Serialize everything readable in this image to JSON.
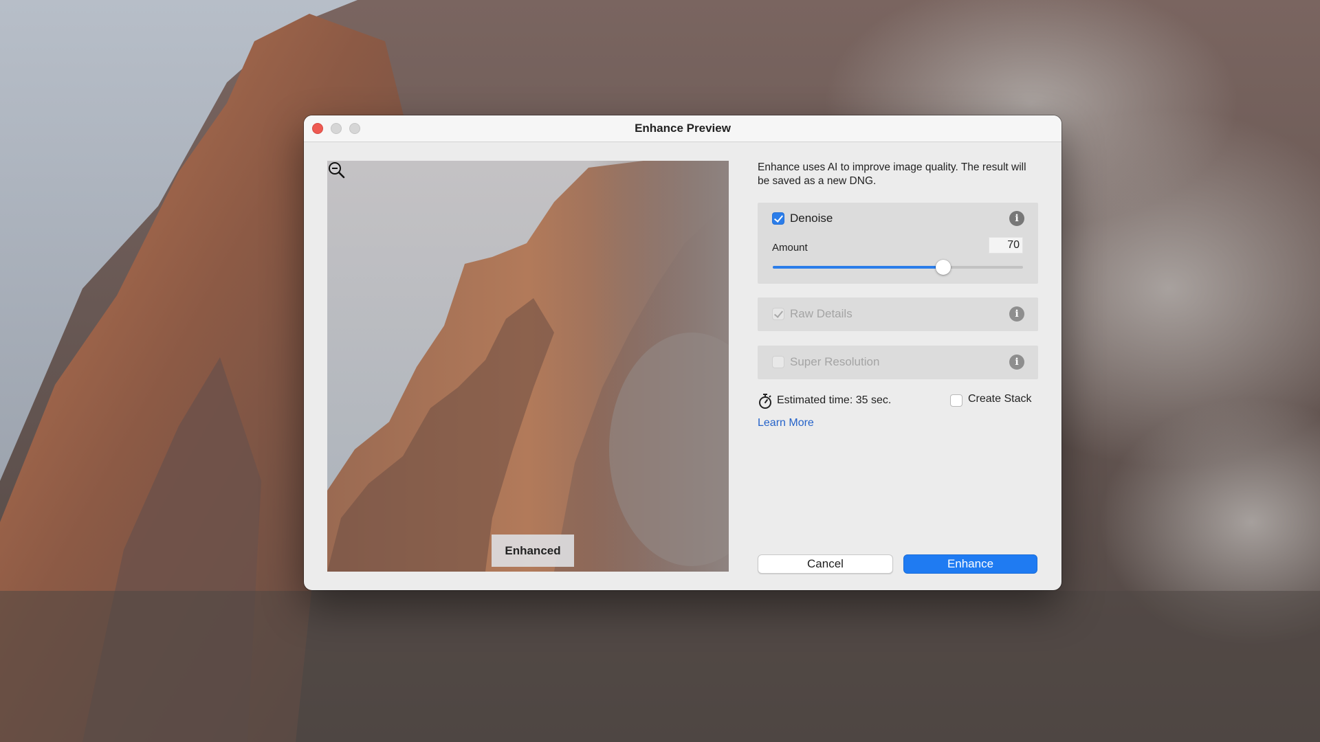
{
  "dialog": {
    "title": "Enhance Preview",
    "description": "Enhance uses AI to improve image quality. The result will be saved as a new DNG.",
    "preview": {
      "badge_label": "Enhanced",
      "zoom_icon": "zoom-out-icon"
    },
    "denoise": {
      "label": "Denoise",
      "checked": true,
      "amount_label": "Amount",
      "amount_value": "70",
      "slider_fraction": 0.68,
      "info_icon": "info-icon"
    },
    "raw_details": {
      "label": "Raw Details",
      "checked": true,
      "enabled": false,
      "info_icon": "info-icon"
    },
    "super_resolution": {
      "label": "Super Resolution",
      "checked": false,
      "enabled": false,
      "info_icon": "info-icon"
    },
    "estimated_time": "Estimated time: 35 sec.",
    "timer_icon": "stopwatch-icon",
    "create_stack": {
      "label": "Create Stack",
      "checked": false
    },
    "learn_more": "Learn More",
    "buttons": {
      "cancel": "Cancel",
      "enhance": "Enhance"
    }
  },
  "colors": {
    "accent": "#1f7bf2",
    "checkbox_checked": "#2b7de9",
    "link": "#2563c9",
    "close_button": "#ee5a52",
    "dialog_bg": "#ececec",
    "group_bg": "#dcdcdc"
  }
}
